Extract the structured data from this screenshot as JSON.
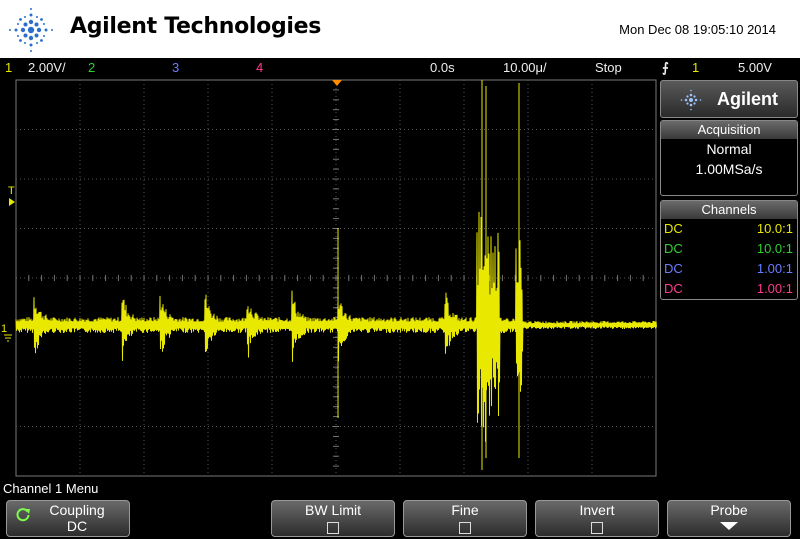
{
  "header": {
    "brand": "Agilent Technologies",
    "datetime": "Mon Dec 08 19:05:10 2014"
  },
  "status": {
    "ch1_num": "1",
    "ch1_scale": "2.00V/",
    "ch2_num": "2",
    "ch3_num": "3",
    "ch4_num": "4",
    "time_delay": "0.0s",
    "time_scale": "10.00μ/",
    "run_state": "Stop",
    "trigger_source": "1",
    "trigger_level": "5.00V"
  },
  "markers": {
    "trigger_marker": "T",
    "ground_marker": "1"
  },
  "panel": {
    "brand": "Agilent",
    "acquisition_title": "Acquisition",
    "acquisition_mode": "Normal",
    "sample_rate": "1.00MSa/s",
    "channels_title": "Channels",
    "channels": [
      {
        "coupling": "DC",
        "probe": "10.0:1",
        "color": "#e8e800"
      },
      {
        "coupling": "DC",
        "probe": "10.0:1",
        "color": "#30d030"
      },
      {
        "coupling": "DC",
        "probe": "1.00:1",
        "color": "#6a7dff"
      },
      {
        "coupling": "DC",
        "probe": "1.00:1",
        "color": "#ff3c8c"
      }
    ]
  },
  "menu": {
    "title": "Channel 1 Menu",
    "coupling_label": "Coupling",
    "coupling_value": "DC",
    "bw_limit_label": "BW Limit",
    "fine_label": "Fine",
    "invert_label": "Invert",
    "probe_label": "Probe"
  },
  "colors": {
    "ch1": "#e8e800",
    "ch2": "#30d030",
    "ch3": "#6a7dff",
    "ch4": "#ff3c8c",
    "trigger_marker": "#ff8c00"
  }
}
